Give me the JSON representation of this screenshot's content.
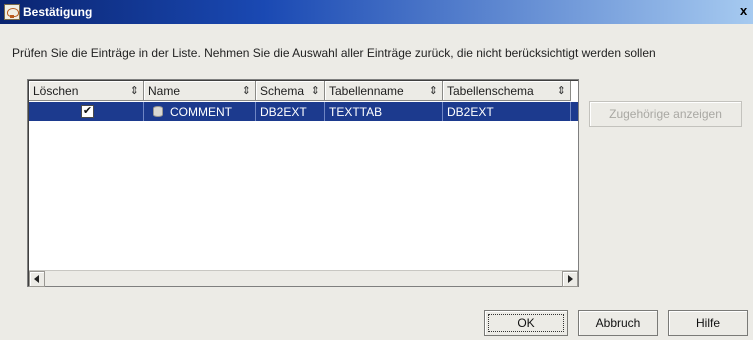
{
  "window": {
    "title": "Bestätigung",
    "close_glyph": "x",
    "icon": "app-icon"
  },
  "prompt": "Prüfen Sie die Einträge in der Liste. Nehmen Sie die Auswahl aller Einträge zurück, die nicht berücksichtigt werden sollen",
  "table": {
    "columns": [
      {
        "label": "Löschen",
        "sort_glyph": "⇕"
      },
      {
        "label": "Name",
        "sort_glyph": "⇕"
      },
      {
        "label": "Schema",
        "sort_glyph": "⇕"
      },
      {
        "label": "Tabellenname",
        "sort_glyph": "⇕"
      },
      {
        "label": "Tabellenschema",
        "sort_glyph": "⇕"
      }
    ],
    "rows": [
      {
        "selected": true,
        "loeschen_checked": true,
        "check_glyph": "✔",
        "name": "COMMENT",
        "schema": "DB2EXT",
        "tabellenname": "TEXTTAB",
        "tabellenschema": "DB2EXT"
      }
    ]
  },
  "buttons": {
    "related": "Zugehörige anzeigen",
    "ok": "OK",
    "cancel": "Abbruch",
    "help": "Hilfe"
  },
  "colors": {
    "selection": "#1c3a8e",
    "dialog_bg": "#ecebe6",
    "title_start": "#0a2470"
  }
}
